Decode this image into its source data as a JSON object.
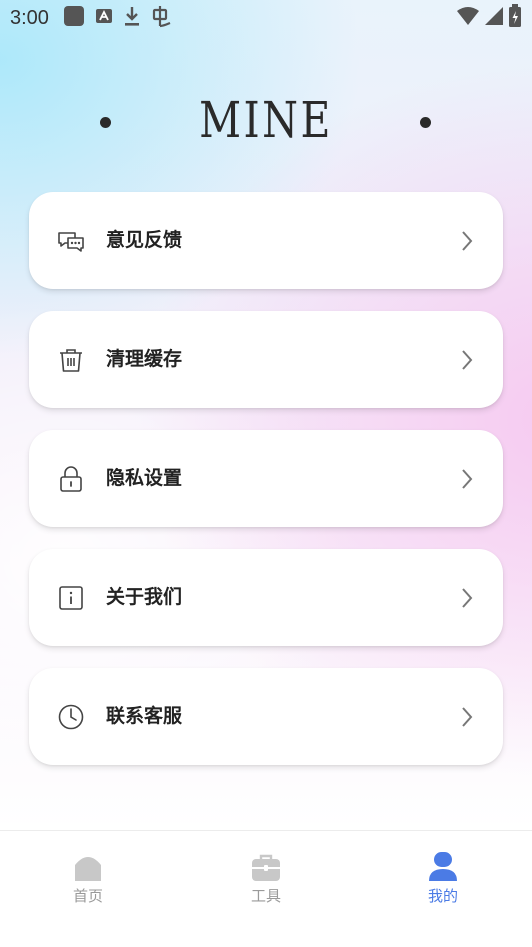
{
  "status_bar": {
    "time": "3:00",
    "icons": [
      "app-square-icon",
      "a-badge-icon",
      "download-icon",
      "bug-icon",
      "wifi-icon",
      "signal-icon",
      "battery-icon"
    ]
  },
  "header": {
    "title": "MINE"
  },
  "menu": {
    "items": [
      {
        "label": "意见反馈",
        "icon": "feedback-chat-icon"
      },
      {
        "label": "清理缓存",
        "icon": "trash-icon"
      },
      {
        "label": "隐私设置",
        "icon": "lock-icon"
      },
      {
        "label": "关于我们",
        "icon": "info-icon"
      },
      {
        "label": "联系客服",
        "icon": "clock-icon"
      }
    ]
  },
  "tab_bar": {
    "tabs": [
      {
        "label": "首页",
        "icon": "home-icon",
        "active": false
      },
      {
        "label": "工具",
        "icon": "toolbox-icon",
        "active": false
      },
      {
        "label": "我的",
        "icon": "user-icon",
        "active": true
      }
    ]
  },
  "colors": {
    "accent": "#4b7be5",
    "inactive": "#c8c8c8",
    "text": "#222222"
  }
}
